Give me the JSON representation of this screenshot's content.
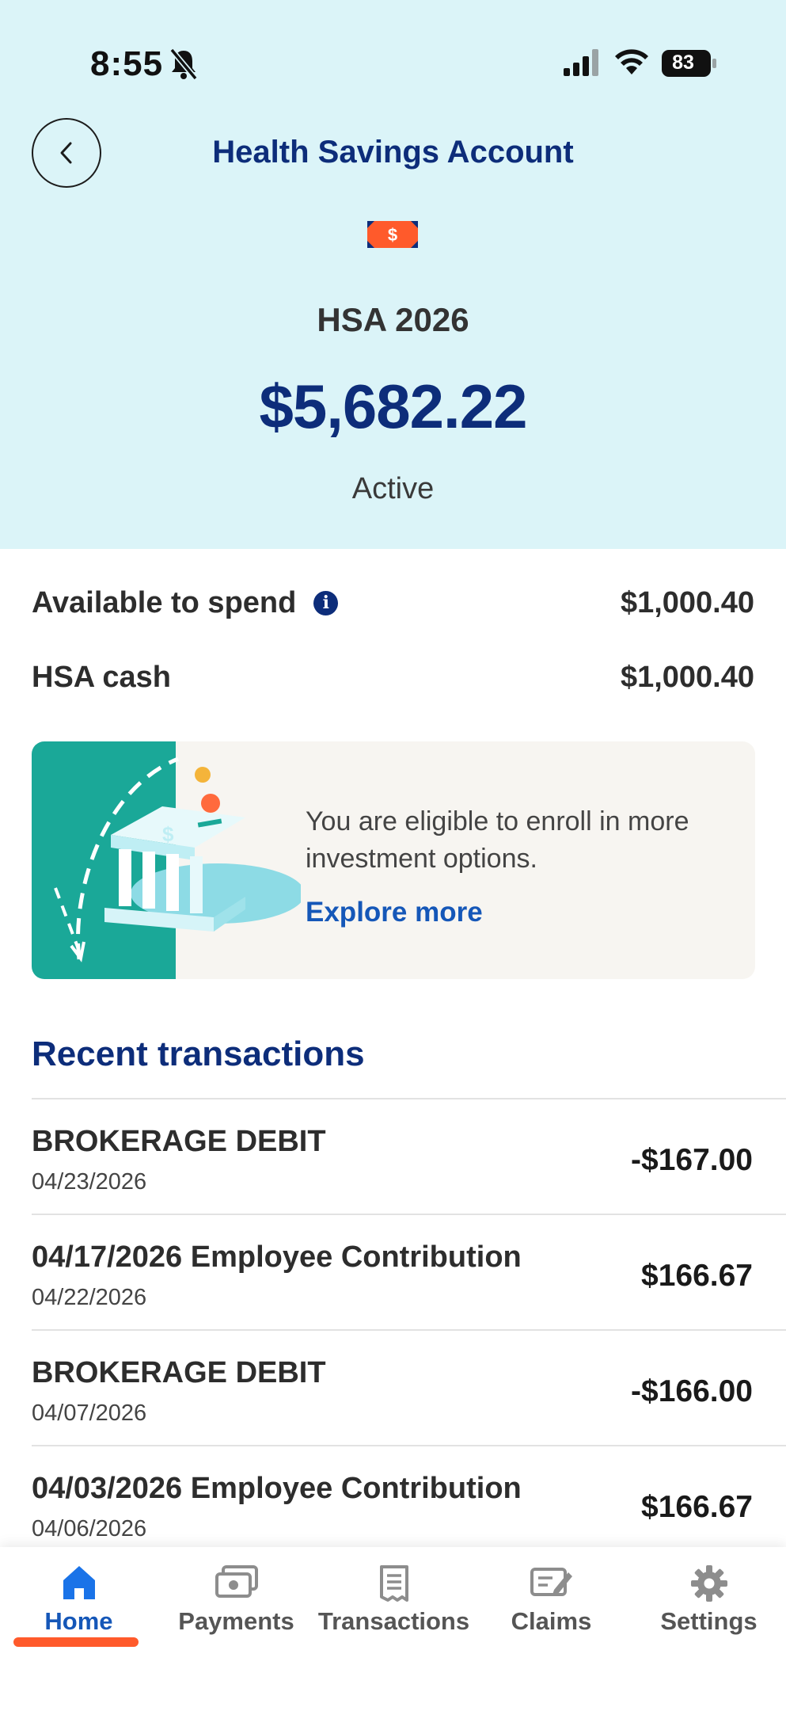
{
  "status_bar": {
    "time": "8:55",
    "battery": "83"
  },
  "header": {
    "title": "Health Savings Account",
    "icon": "dollar-bill-icon",
    "account_name": "HSA 2026",
    "balance": "$5,682.22",
    "status": "Active"
  },
  "summary": {
    "available_label": "Available to spend",
    "available_value": "$1,000.40",
    "cash_label": "HSA cash",
    "cash_value": "$1,000.40"
  },
  "promo": {
    "message": "You are eligible to enroll in more investment options.",
    "link": "Explore more"
  },
  "transactions": {
    "title": "Recent transactions",
    "items": [
      {
        "description": "BROKERAGE DEBIT",
        "date": "04/23/2026",
        "amount": "-$167.00"
      },
      {
        "description": "04/17/2026 Employee Contribution",
        "date": "04/22/2026",
        "amount": "$166.67"
      },
      {
        "description": "BROKERAGE DEBIT",
        "date": "04/07/2026",
        "amount": "-$166.00"
      },
      {
        "description": "04/03/2026 Employee Contribution",
        "date": "04/06/2026",
        "amount": "$166.67"
      }
    ]
  },
  "nav": {
    "items": [
      {
        "label": "Home",
        "icon": "home-icon",
        "active": true
      },
      {
        "label": "Payments",
        "icon": "cash-icon"
      },
      {
        "label": "Transactions",
        "icon": "receipt-icon"
      },
      {
        "label": "Claims",
        "icon": "claim-edit-icon"
      },
      {
        "label": "Settings",
        "icon": "gear-icon"
      }
    ]
  },
  "colors": {
    "header_bg": "#dbf4f8",
    "brand_navy": "#0d2d7a",
    "link_blue": "#1557b8",
    "accent_orange": "#ff5a2b",
    "teal": "#1aa898"
  }
}
